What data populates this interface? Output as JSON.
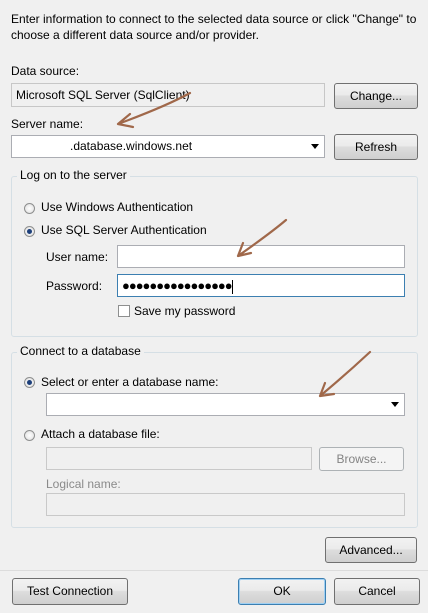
{
  "intro_text": "Enter information to connect to the selected data source or click \"Change\" to choose a different data source and/or provider.",
  "data_source": {
    "label": "Data source:",
    "value": "Microsoft SQL Server (SqlClient)",
    "change_button": "Change..."
  },
  "server": {
    "label": "Server name:",
    "value": ".database.windows.net",
    "refresh_button": "Refresh"
  },
  "logon": {
    "title": "Log on to the server",
    "windows_auth_label": "Use Windows Authentication",
    "windows_auth_selected": false,
    "sql_auth_label": "Use SQL Server Authentication",
    "sql_auth_selected": true,
    "username_label": "User name:",
    "username_value": "",
    "password_label": "Password:",
    "password_mask": "●●●●●●●●●●●●●●●●",
    "save_password_label": "Save my password",
    "save_password_checked": false
  },
  "database": {
    "title": "Connect to a database",
    "select_label": "Select or enter a database name:",
    "select_selected": true,
    "select_value": "",
    "attach_label": "Attach a database file:",
    "attach_selected": false,
    "attach_value": "",
    "browse_button": "Browse...",
    "logical_name_label": "Logical name:",
    "logical_name_value": ""
  },
  "buttons": {
    "advanced": "Advanced...",
    "test_connection": "Test Connection",
    "ok": "OK",
    "cancel": "Cancel"
  },
  "annotation_color": "#a0684a"
}
